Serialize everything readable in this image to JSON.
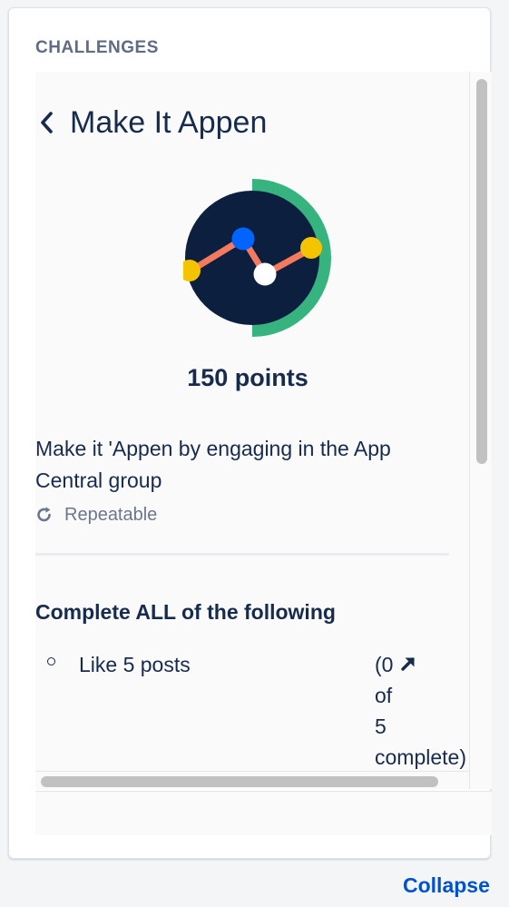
{
  "panel": {
    "title": "CHALLENGES"
  },
  "challenge": {
    "title": "Make It Appen",
    "points": "150 points",
    "description": "Make it 'Appen by engaging in the App Central group",
    "repeatable_label": "Repeatable",
    "badge_progress_fraction": 0.5,
    "badge_colors": {
      "background": "#0c1f3f",
      "ring": "#36b37e",
      "line": "#f37a5e",
      "node_blue": "#0065ff",
      "node_yellow": "#f5c400",
      "node_white": "#ffffff"
    }
  },
  "requirements": {
    "heading": "Complete ALL of the following",
    "items": [
      {
        "label": "Like 5 posts",
        "progress_open": "(0",
        "progress_of": "of",
        "progress_total": "5",
        "progress_close": "complete)"
      }
    ]
  },
  "footer": {
    "collapse_label": "Collapse"
  },
  "icons": {
    "back": "chevron-left-icon",
    "repeat": "refresh-icon",
    "link": "arrow-up-right-icon",
    "bullet": "circle-bullet-icon"
  }
}
